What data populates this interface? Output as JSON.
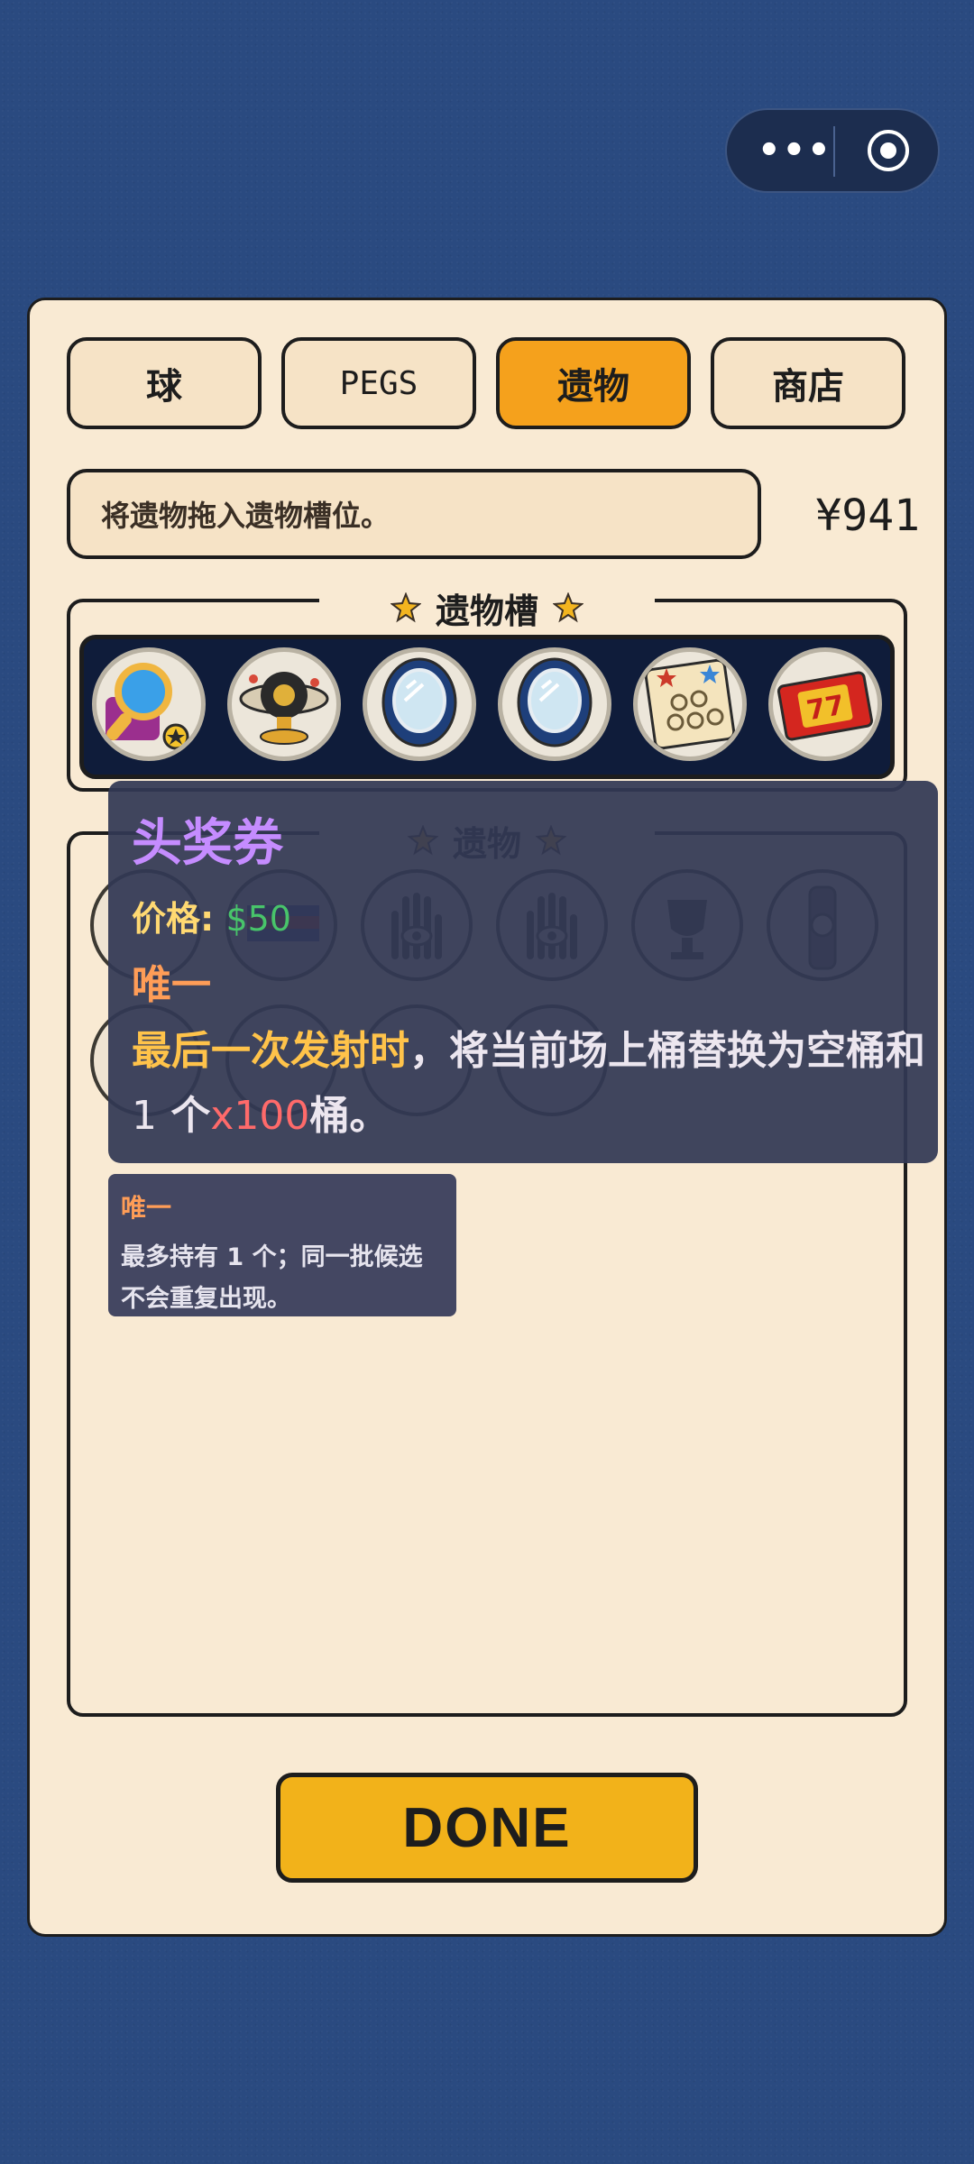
{
  "capsule": {
    "more_icon": "more-dots-icon",
    "close_icon": "target-icon",
    "dots": "•••"
  },
  "tabs": [
    {
      "label": "球",
      "active": false
    },
    {
      "label": "PEGS",
      "active": false
    },
    {
      "label": "遗物",
      "active": true
    },
    {
      "label": "商店",
      "active": false
    }
  ],
  "hint_text": "将遗物拖入遗物槽位。",
  "money": "¥941",
  "relic_slots": {
    "title": "遗物槽",
    "items": [
      {
        "icon": "magnifier-icon"
      },
      {
        "icon": "orb-icon"
      },
      {
        "icon": "mirror-icon"
      },
      {
        "icon": "mirror-icon"
      },
      {
        "icon": "bingo-card-icon"
      },
      {
        "icon": "jackpot-ticket-icon"
      }
    ]
  },
  "relics_section": {
    "title": "遗物",
    "items": [
      {
        "icon": "gear-icon"
      },
      {
        "icon": "flag-icon"
      },
      {
        "icon": "eye-hand-icon"
      },
      {
        "icon": "eye-hand-icon"
      },
      {
        "icon": "trophy-icon"
      },
      {
        "icon": "cannon-icon"
      },
      {
        "icon": "key-icon"
      },
      {
        "icon": "stopwatch-icon"
      },
      {
        "icon": "stopwatch-icon"
      },
      {
        "icon": "stopwatch-icon"
      }
    ]
  },
  "tooltip": {
    "title": "头奖券",
    "price_label": "价格",
    "price_sep": ":",
    "price_value": "$50",
    "tag": "唯一",
    "desc_highlight": "最后一次发射时",
    "desc_part1": "，将当前场上桶替换为空桶和 ",
    "desc_count": "1",
    "desc_part2": " 个",
    "desc_multiplier": "x100",
    "desc_part3": "桶。"
  },
  "tag_tooltip": {
    "title": "唯一",
    "text": "最多持有 1 个；同一批候选不会重复出现。"
  },
  "done_label": "DONE",
  "colors": {
    "background": "#2a4a80",
    "panel": "#f9ead3",
    "active_tab": "#f5a11c",
    "done_button": "#f2b21a",
    "tooltip_title": "#c58cff",
    "price_value": "#48c46a",
    "unique_tag": "#ff9d57",
    "highlight": "#ffc34a",
    "multiplier": "#ff6a6a"
  }
}
